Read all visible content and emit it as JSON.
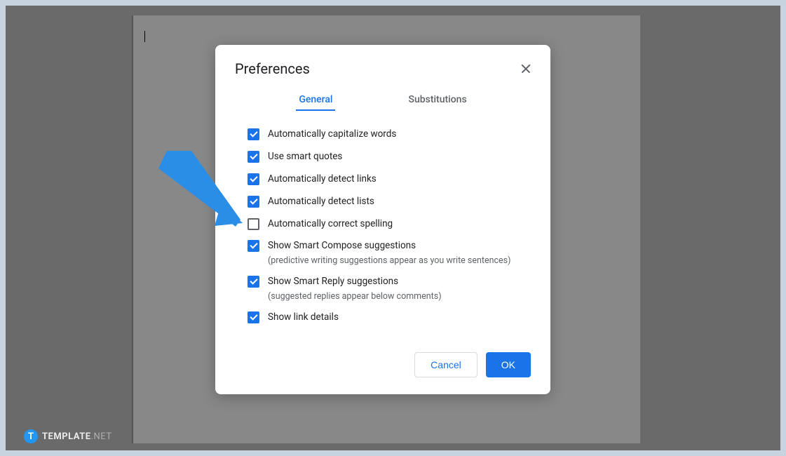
{
  "dialog": {
    "title": "Preferences",
    "tabs": {
      "general": "General",
      "substitutions": "Substitutions"
    },
    "options": [
      {
        "label": "Automatically capitalize words",
        "checked": true,
        "desc": ""
      },
      {
        "label": "Use smart quotes",
        "checked": true,
        "desc": ""
      },
      {
        "label": "Automatically detect links",
        "checked": true,
        "desc": ""
      },
      {
        "label": "Automatically detect lists",
        "checked": true,
        "desc": ""
      },
      {
        "label": "Automatically correct spelling",
        "checked": false,
        "desc": ""
      },
      {
        "label": "Show Smart Compose suggestions",
        "checked": true,
        "desc": "(predictive writing suggestions appear as you write sentences)"
      },
      {
        "label": "Show Smart Reply suggestions",
        "checked": true,
        "desc": "(suggested replies appear below comments)"
      },
      {
        "label": "Show link details",
        "checked": true,
        "desc": ""
      }
    ],
    "buttons": {
      "cancel": "Cancel",
      "ok": "OK"
    }
  },
  "watermark": {
    "icon": "T",
    "text": "TEMPLATE",
    "suffix": ".NET"
  }
}
